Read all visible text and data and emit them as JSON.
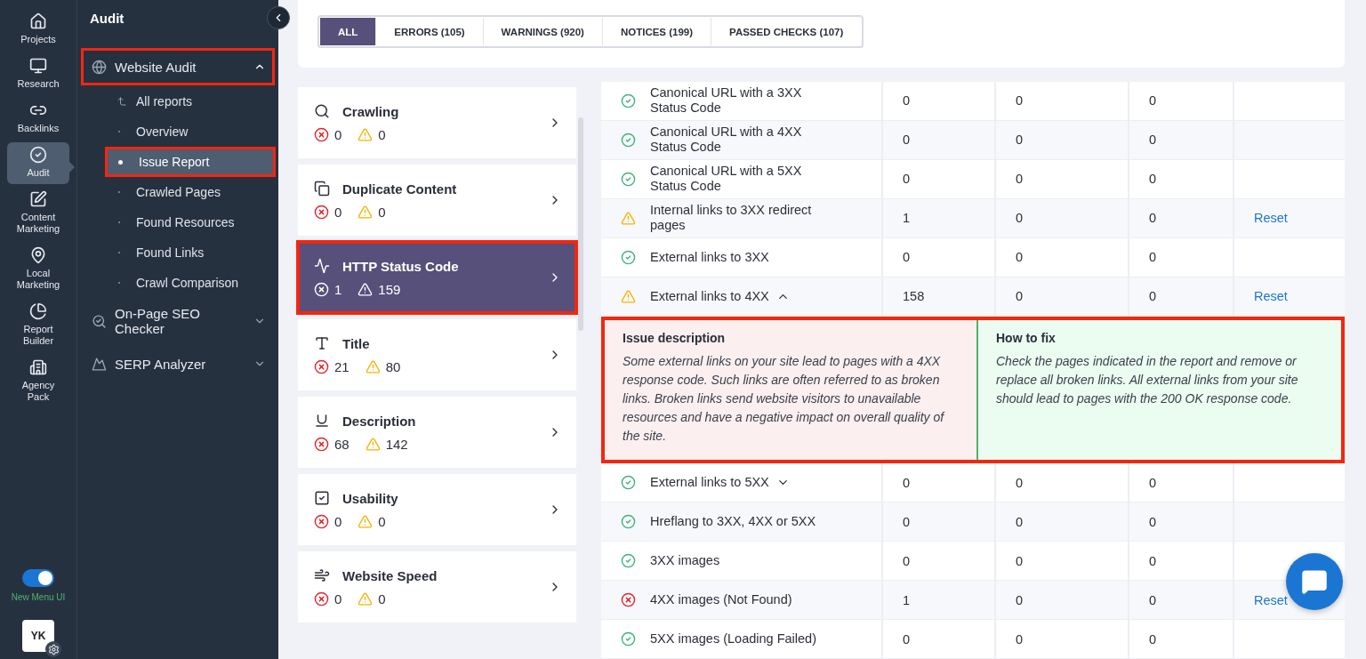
{
  "rail": {
    "items": [
      {
        "label": "Projects",
        "selected": false
      },
      {
        "label": "Research",
        "selected": false
      },
      {
        "label": "Backlinks",
        "selected": false
      },
      {
        "label": "Audit",
        "selected": true
      },
      {
        "label": "Content Marketing",
        "selected": false
      },
      {
        "label": "Local Marketing",
        "selected": false
      },
      {
        "label": "Report Builder",
        "selected": false
      },
      {
        "label": "Agency Pack",
        "selected": false
      }
    ],
    "toggle": {
      "label": "New Menu UI",
      "on": true
    },
    "avatar": {
      "initials": "YK"
    }
  },
  "nav": {
    "title": "Audit",
    "sections": [
      {
        "label": "Website Audit",
        "expanded": true,
        "highlighted": true,
        "children": [
          {
            "label": "All reports",
            "kind": "back",
            "selected": false,
            "highlighted": false
          },
          {
            "label": "Overview",
            "kind": "page",
            "selected": false,
            "highlighted": false
          },
          {
            "label": "Issue Report",
            "kind": "page",
            "selected": true,
            "highlighted": true
          },
          {
            "label": "Crawled Pages",
            "kind": "page",
            "selected": false,
            "highlighted": false
          },
          {
            "label": "Found Resources",
            "kind": "page",
            "selected": false,
            "highlighted": false
          },
          {
            "label": "Found Links",
            "kind": "page",
            "selected": false,
            "highlighted": false
          },
          {
            "label": "Crawl Comparison",
            "kind": "page",
            "selected": false,
            "highlighted": false
          }
        ]
      },
      {
        "label": "On-Page SEO Checker",
        "expanded": false,
        "highlighted": false
      },
      {
        "label": "SERP Analyzer",
        "expanded": false,
        "highlighted": false
      }
    ]
  },
  "filter_tabs": [
    {
      "label": "ALL",
      "selected": true
    },
    {
      "label": "ERRORS (105)",
      "selected": false
    },
    {
      "label": "WARNINGS (920)",
      "selected": false
    },
    {
      "label": "NOTICES (199)",
      "selected": false
    },
    {
      "label": "PASSED CHECKS (107)",
      "selected": false
    }
  ],
  "categories": [
    {
      "name": "Crawling",
      "errors": "0",
      "warnings": "0",
      "selected": false,
      "highlighted": false
    },
    {
      "name": "Duplicate Content",
      "errors": "0",
      "warnings": "0",
      "selected": false,
      "highlighted": false
    },
    {
      "name": "HTTP Status Code",
      "errors": "1",
      "warnings": "159",
      "selected": true,
      "highlighted": true
    },
    {
      "name": "Title",
      "errors": "21",
      "warnings": "80",
      "selected": false,
      "highlighted": false
    },
    {
      "name": "Description",
      "errors": "68",
      "warnings": "142",
      "selected": false,
      "highlighted": false
    },
    {
      "name": "Usability",
      "errors": "0",
      "warnings": "0",
      "selected": false,
      "highlighted": false
    },
    {
      "name": "Website Speed",
      "errors": "0",
      "warnings": "0",
      "selected": false,
      "highlighted": false
    }
  ],
  "table": {
    "rows": [
      {
        "kind": "ok",
        "name": "Canonical URL with a 3XX Status Code",
        "column_2": "0",
        "column_3": "0",
        "column_4": "0"
      },
      {
        "kind": "ok",
        "name": "Canonical URL with a 4XX Status Code",
        "column_2": "0",
        "column_3": "0",
        "column_4": "0"
      },
      {
        "kind": "ok",
        "name": "Canonical URL with a 5XX Status Code",
        "column_2": "0",
        "column_3": "0",
        "column_4": "0"
      },
      {
        "kind": "warning",
        "name": "Internal links to 3XX redirect pages",
        "column_2": "1",
        "column_3": "0",
        "column_4": "0",
        "action": "Reset"
      },
      {
        "kind": "ok",
        "name": "External links to 3XX",
        "column_2": "0",
        "column_3": "0",
        "column_4": "0"
      },
      {
        "kind": "warning",
        "name": "External links to 4XX",
        "expanded": true,
        "column_2": "158",
        "column_3": "0",
        "column_4": "0",
        "action": "Reset",
        "detail": {
          "highlighted": true,
          "description_title": "Issue description",
          "description": "Some external links on your site lead to pages with a 4XX response code. Such links are often referred to as broken links. Broken links send website visitors to unavailable resources and have a negative impact on overall quality of the site.",
          "fix_title": "How to fix",
          "fix": "Check the pages indicated in the report and remove or replace all broken links. All external links from your site should lead to pages with the 200 OK response code."
        }
      },
      {
        "kind": "ok",
        "name": "External links to 5XX",
        "expanded": false,
        "column_2": "0",
        "column_3": "0",
        "column_4": "0"
      },
      {
        "kind": "ok",
        "name": "Hreflang to 3XX, 4XX or 5XX",
        "column_2": "0",
        "column_3": "0",
        "column_4": "0"
      },
      {
        "kind": "ok",
        "name": "3XX images",
        "column_2": "0",
        "column_3": "0",
        "column_4": "0"
      },
      {
        "kind": "error",
        "name": "4XX images (Not Found)",
        "column_2": "1",
        "column_3": "0",
        "column_4": "0",
        "action": "Reset"
      },
      {
        "kind": "ok",
        "name": "5XX images (Loading Failed)",
        "column_2": "0",
        "column_3": "0",
        "column_4": "0"
      }
    ]
  }
}
